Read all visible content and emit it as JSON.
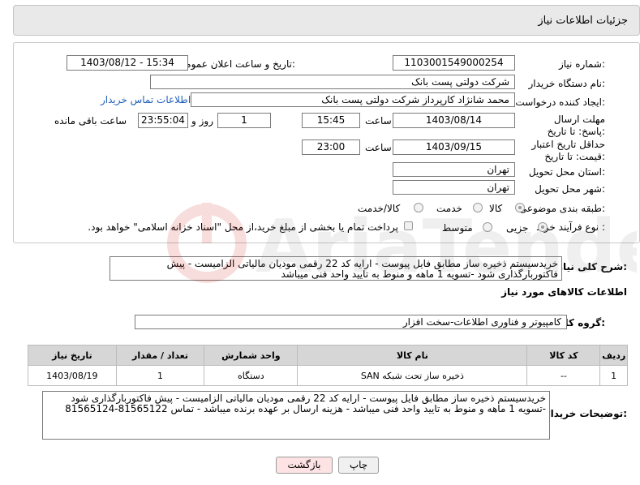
{
  "header": {
    "title": "جزئیات اطلاعات نیاز"
  },
  "form": {
    "need_number": {
      "label": "شماره نیاز:",
      "value": "1103001549000254"
    },
    "announce_datetime": {
      "label": "تاریخ و ساعت اعلان عمومی:",
      "value": "1403/08/12 - 15:34"
    },
    "buyer_org": {
      "label": "نام دستگاه خریدار:",
      "value": "شرکت دولتی پست بانک"
    },
    "requester": {
      "label": "ایجاد کننده درخواست:",
      "value": "محمد شانژاد کارپرداز شرکت دولتی پست بانک",
      "link": "اطلاعات تماس خریدار"
    },
    "reply_deadline": {
      "label": "مهلت ارسال پاسخ: تا تاریخ:",
      "date": "1403/08/14",
      "time_label": "ساعت",
      "time": "15:45",
      "days": "1",
      "days_label": "روز و",
      "remaining": "23:55:04",
      "remaining_label": "ساعت باقی مانده"
    },
    "price_validity": {
      "label": "حداقل تاریخ اعتبار قیمت: تا تاریخ:",
      "date": "1403/09/15",
      "time_label": "ساعت",
      "time": "23:00"
    },
    "province": {
      "label": "استان محل تحویل:",
      "value": "تهران"
    },
    "city": {
      "label": "شهر محل تحویل:",
      "value": "تهران"
    },
    "category": {
      "label": "طبقه بندی موضوعی:",
      "options": [
        "کالا",
        "خدمت",
        "کالا/خدمت"
      ]
    },
    "process": {
      "label": "نوع فرآیند خرید :",
      "options": [
        "جزیی",
        "متوسط"
      ],
      "payment_note": "پرداخت تمام یا بخشی از مبلغ خرید،از محل \"اسناد خزانه اسلامی\" خواهد بود."
    }
  },
  "summary": {
    "label": "شرح کلی نیاز:",
    "text": "خریدسیستم ذخیره ساز مطابق فایل پیوست - ارایه کد 22 رقمی مودیان مالیاتی الزامیست - پیش فاکتوربارگذاری شود -تسویه 1 ماهه و منوط به تایید واحد فنی میباشد"
  },
  "goods": {
    "section_title": "اطلاعات کالاهای مورد نیاز",
    "group_label": "گروه کالا:",
    "group_value": "کامپیوتر و فناوری اطلاعات-سخت افزار",
    "columns": [
      "ردیف",
      "کد کالا",
      "نام کالا",
      "واحد شمارش",
      "تعداد / مقدار",
      "تاریخ نیاز"
    ],
    "rows": [
      [
        "1",
        "--",
        "ذخیره ساز تحت شبکه SAN",
        "دستگاه",
        "1",
        "1403/08/19"
      ]
    ]
  },
  "buyer_notes": {
    "label": "توضیحات خریدار:",
    "text": "خریدسیستم ذخیره ساز مطابق فایل پیوست - ارایه کد 22 رقمی مودیان مالیاتی الزامیست - پیش فاکتوربارگذاری شود -تسویه 1 ماهه و منوط به تایید واحد فنی میباشد - هزینه ارسال بر عهده برنده میباشد - تماس 81565122-81565124"
  },
  "buttons": {
    "print": "چاپ",
    "back": "بازگشت"
  },
  "colors": {
    "back_button_bg": "#fde3e3",
    "print_button_bg": "#f0f0f0",
    "link": "#1f5fb8"
  }
}
